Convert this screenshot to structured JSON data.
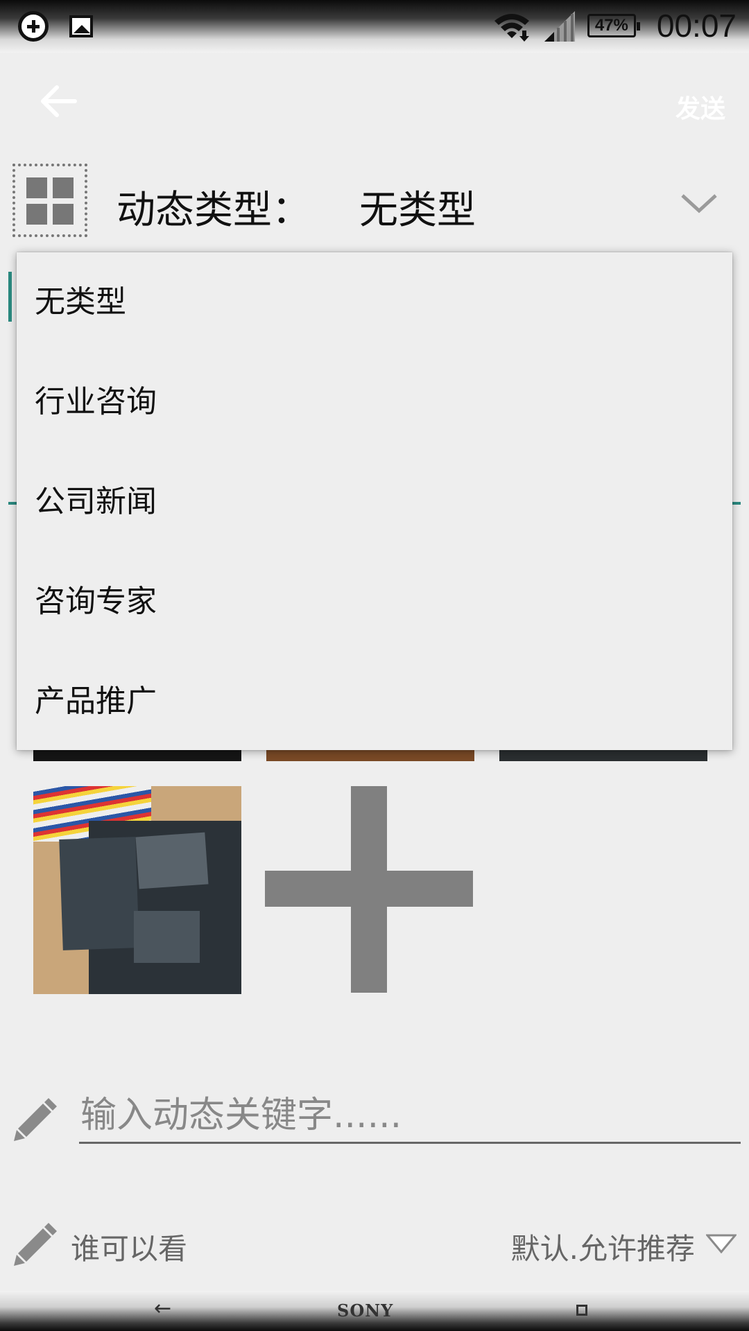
{
  "status_bar": {
    "battery": "47%",
    "time": "00:07",
    "icons": [
      "add-circle-icon",
      "image-icon",
      "wifi-icon",
      "signal-icon",
      "battery-icon"
    ]
  },
  "app_bar": {
    "send_label": "发送"
  },
  "type_selector": {
    "label": "动态类型：",
    "value": "无类型"
  },
  "dropdown": {
    "options": [
      "无类型",
      "行业咨询",
      "公司新闻",
      "咨询专家",
      "产品推广"
    ]
  },
  "keyword": {
    "placeholder": "输入动态关键字......",
    "value": ""
  },
  "visibility": {
    "label": "谁可以看",
    "value": "默认.允许推荐"
  },
  "nav_bar": {
    "back_glyph": "←",
    "brand": "SONY"
  },
  "colors": {
    "accent": "#2a8a80",
    "background": "#eeeeee",
    "add_icon": "#808080"
  }
}
